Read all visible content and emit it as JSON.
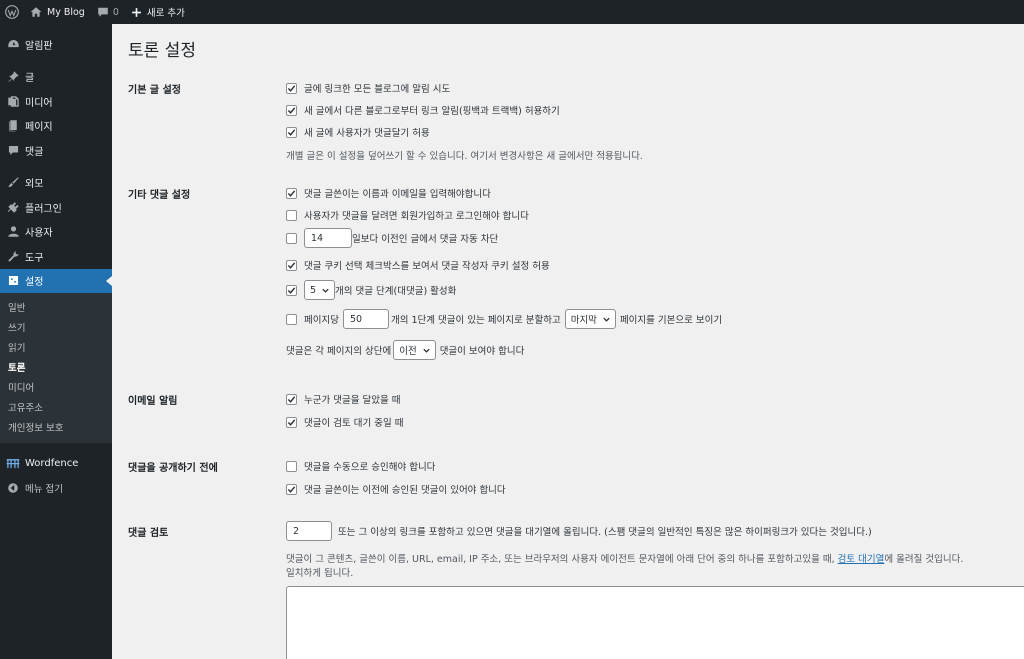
{
  "adminbar": {
    "site_name": "My Blog",
    "comments_count": "0",
    "new_label": "새로 추가"
  },
  "sidebar": {
    "items": [
      {
        "label": "알림판",
        "icon": "dashboard-icon"
      },
      {
        "label": "글",
        "icon": "pin-icon"
      },
      {
        "label": "미디어",
        "icon": "media-icon"
      },
      {
        "label": "페이지",
        "icon": "page-icon"
      },
      {
        "label": "댓글",
        "icon": "comment-icon"
      },
      {
        "label": "외모",
        "icon": "brush-icon"
      },
      {
        "label": "플러그인",
        "icon": "plugin-icon"
      },
      {
        "label": "사용자",
        "icon": "user-icon"
      },
      {
        "label": "도구",
        "icon": "wrench-icon"
      },
      {
        "label": "설정",
        "icon": "settings-icon"
      }
    ],
    "submenu": [
      "일반",
      "쓰기",
      "읽기",
      "토론",
      "미디어",
      "고유주소",
      "개인정보 보호"
    ],
    "wordfence": "Wordfence",
    "collapse": "메뉴 접기"
  },
  "page": {
    "title": "토론 설정"
  },
  "sections": {
    "default_post": {
      "label": "기본 글 설정",
      "opt1": "글에 링크한 모든 블로그에 알림 시도",
      "opt2": "새 글에서 다른 블로그로부터 링크 알림(핑백과 트랙백) 허용하기",
      "opt3": "새 글에 사용자가 댓글달기 허용",
      "desc": "개별 글은 이 설정을 덮어쓰기 할 수 있습니다. 여기서 변경사항은 새 글에서만 적용됩니다."
    },
    "other_comment": {
      "label": "기타 댓글 설정",
      "opt1": "댓글 글쓴이는 이름과 이메일을 입력해야합니다",
      "opt2": "사용자가 댓글을 달려면 회원가입하고 로그인해야 합니다",
      "close_days": "14",
      "opt3": "일보다 이전인 글에서 댓글 자동 차단",
      "opt4": "댓글 쿠키 선택 체크박스를 보여서 댓글 작성자 쿠키 설정 허용",
      "thread_depth": "5",
      "opt5": "개의 댓글 단계(대댓글) 활성화",
      "opt6_pre": "페이지당",
      "per_page": "50",
      "opt6_mid": "개의 1단계 댓글이 있는 페이지로 분할하고",
      "page_sel": "마지막",
      "opt6_post": "페이지를 기본으로 보이기",
      "order_pre": "댓글은 각 페이지의 상단에",
      "order_sel": "이전",
      "order_post": "댓글이 보여야 합니다"
    },
    "email": {
      "label": "이메일 알림",
      "opt1": "누군가 댓글을 달았을 때",
      "opt2": "댓글이 검토 대기 중일 때"
    },
    "before_appear": {
      "label": "댓글을 공개하기 전에",
      "opt1": "댓글을 수동으로 승인해야 합니다",
      "opt2": "댓글 글쓴이는 이전에 승인된 댓글이 있어야 합니다"
    },
    "moderation": {
      "label": "댓글 검토",
      "links": "2",
      "links_text": "또는 그 이상의 링크를 포함하고 있으면 댓글을 대기열에 올립니다. (스팸 댓글의 일반적인 특징은 많은 하이퍼링크가 있다는 것입니다.)",
      "desc1_pre": "댓글이 그 콘텐츠, 글쓴이 이름, URL, email, IP 주소, 또는 브라우저의 사용자 에이전트 문자열에 아래 단어 중의 하나를 포함하고있을 때,",
      "desc1_link": "검토 대기열",
      "desc1_post": "에 올려질 것입니다.",
      "desc2": "일치하게 됩니다."
    }
  }
}
